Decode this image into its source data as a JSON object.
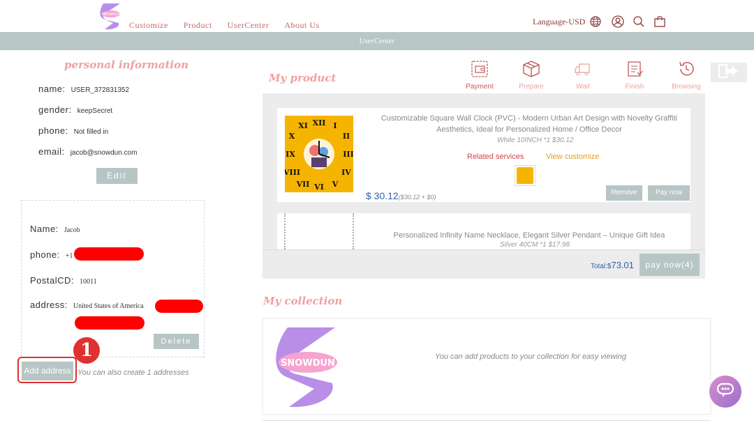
{
  "nav": {
    "items": [
      "Customize",
      "Product",
      "UserCenter",
      "About Us"
    ],
    "language": "Language-USD"
  },
  "band": {
    "title": "UserCenter"
  },
  "personal": {
    "title": "personal information",
    "name_label": "name:",
    "name_value": "USER_372831352",
    "gender_label": "gender:",
    "gender_value": "keepSecret",
    "phone_label": "phone:",
    "phone_value": "Not filled in",
    "email_label": "email:",
    "email_value": "jacob@snowdun.com",
    "edit_label": "Edit"
  },
  "address": {
    "name_label": "Name:",
    "name_value": "Jacob",
    "phone_label": "phone:",
    "phone_value": "+1",
    "postal_label": "PostalCD:",
    "postal_value": "10011",
    "address_label": "address:",
    "address_value": "United States of America",
    "delete_label": "Delete",
    "add_label": "Add address",
    "hint": "You can also create 1 addresses",
    "marker": "1"
  },
  "my_product": {
    "title": "My product",
    "statuses": [
      {
        "label": "Payment",
        "icon": "wallet-icon",
        "active": true
      },
      {
        "label": "Prepare",
        "icon": "box-icon",
        "active": false
      },
      {
        "label": "Wait",
        "icon": "truck-icon",
        "active": false
      },
      {
        "label": "Finish",
        "icon": "clipboard-icon",
        "active": false
      },
      {
        "label": "Browsing",
        "icon": "history-icon",
        "active": false
      }
    ],
    "items": [
      {
        "title_line1": "Customizable Square Wall Clock (PVC) - Modern Urban Art Design with Novelty Graffiti",
        "title_line2": "Aesthetics, Ideal for Personalized Home / Office Decor",
        "spec": "White 10INCH *1 $30.12",
        "related": "Related services",
        "view": "View customize",
        "price": "$ 30.12",
        "price_detail": "($30.12 + $0)",
        "remove": "Remove",
        "pay": "Pay now"
      },
      {
        "title_line1": "Personalized Infinity Name Necklace, Elegant Silver Pendant – Unique Gift Idea",
        "spec": "Silver 40CM *1 $17.98"
      }
    ],
    "total_label": "Total:$",
    "total_value": "73.01",
    "pay_all": "pay now(4)"
  },
  "collection": {
    "title": "My collection",
    "hint": "You can add products to your collection for easy viewing",
    "logo_text": "SNOWDUN"
  },
  "colors": {
    "accent_pink": "#f0a0a0",
    "button_gray": "#b7c5c5",
    "price_blue": "#2e5fa8",
    "nav_red": "#c26a6a"
  }
}
